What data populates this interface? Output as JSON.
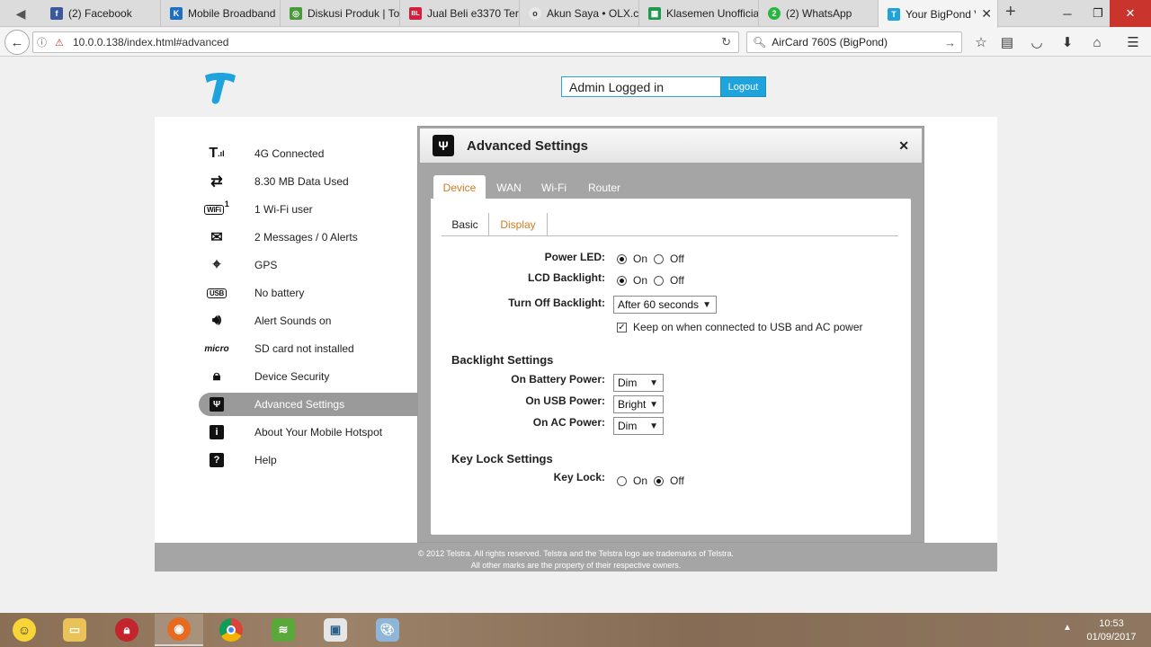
{
  "browser": {
    "tabs": [
      {
        "title": "(2) Facebook",
        "favicon_color": "#3b5998",
        "favicon_glyph": "f"
      },
      {
        "title": "Mobile Broadband",
        "favicon_color": "#1e6fbf",
        "favicon_glyph": "K"
      },
      {
        "title": "Diskusi Produk | To",
        "favicon_color": "#4a9a3c",
        "favicon_glyph": "◎"
      },
      {
        "title": "Jual Beli e3370 Terr",
        "favicon_color": "#d11f3c",
        "favicon_glyph": "BL"
      },
      {
        "title": "Akun Saya • OLX.co",
        "favicon_color": "#e8e8e8",
        "favicon_glyph": "o"
      },
      {
        "title": "Klasemen Unofficia",
        "favicon_color": "#1e9a4e",
        "favicon_glyph": "▦"
      },
      {
        "title": "(2) WhatsApp",
        "favicon_color": "#2ab540",
        "favicon_glyph": "2"
      },
      {
        "title": "Your BigPond V",
        "favicon_color": "#1ea3dd",
        "favicon_glyph": "T"
      }
    ],
    "url": "10.0.0.138/index.html#advanced",
    "search_value": "AirCard 760S (BigPond)"
  },
  "header": {
    "login_status": "Admin Logged in",
    "logout_label": "Logout"
  },
  "sidebar": {
    "items": [
      {
        "label": "4G Connected",
        "icon": "signal-icon"
      },
      {
        "label": "8.30 MB Data Used",
        "icon": "data-transfer-icon"
      },
      {
        "label": "1 Wi-Fi user",
        "icon": "wifi-icon",
        "icon_text": "WiFi",
        "sup": "1"
      },
      {
        "label": "2 Messages / 0 Alerts",
        "icon": "envelope-icon"
      },
      {
        "label": "GPS",
        "icon": "crosshair-icon"
      },
      {
        "label": "No battery",
        "icon": "usb-icon",
        "icon_text": "USB"
      },
      {
        "label": "Alert Sounds on",
        "icon": "speaker-icon"
      },
      {
        "label": "SD card not installed",
        "icon": "micro-sd-icon",
        "icon_text": "micro"
      },
      {
        "label": "Device Security",
        "icon": "lock-icon"
      },
      {
        "label": "Advanced Settings",
        "icon": "wrench-icon"
      },
      {
        "label": "About Your Mobile Hotspot",
        "icon": "info-icon"
      },
      {
        "label": "Help",
        "icon": "help-icon"
      }
    ],
    "active": "Advanced Settings"
  },
  "panel": {
    "title": "Advanced Settings",
    "tabs": [
      "Device",
      "WAN",
      "Wi-Fi",
      "Router"
    ],
    "active_tab": "Device",
    "subtabs": [
      "Basic",
      "Display"
    ],
    "active_subtab": "Display",
    "power_led": {
      "label": "Power LED:",
      "on": "On",
      "off": "Off",
      "value": "On"
    },
    "lcd_backlight": {
      "label": "LCD Backlight:",
      "on": "On",
      "off": "Off",
      "value": "On"
    },
    "turn_off_backlight": {
      "label": "Turn Off Backlight:",
      "value": "After 60 seconds"
    },
    "keep_on": {
      "label": "Keep on when connected to USB and AC power",
      "checked": true
    },
    "backlight_settings": {
      "heading": "Backlight Settings",
      "battery": {
        "label": "On Battery Power:",
        "value": "Dim"
      },
      "usb": {
        "label": "On USB Power:",
        "value": "Bright"
      },
      "ac": {
        "label": "On AC Power:",
        "value": "Dim"
      }
    },
    "key_lock_settings": {
      "heading": "Key Lock Settings",
      "key_lock": {
        "label": "Key Lock:",
        "on": "On",
        "off": "Off",
        "value": "Off"
      }
    }
  },
  "footer": {
    "line1": "© 2012 Telstra. All rights reserved. Telstra and the Telstra logo are trademarks of Telstra.",
    "line2": "All other marks are the property of their respective owners."
  },
  "taskbar": {
    "time": "10:53",
    "date": "01/09/2017"
  }
}
